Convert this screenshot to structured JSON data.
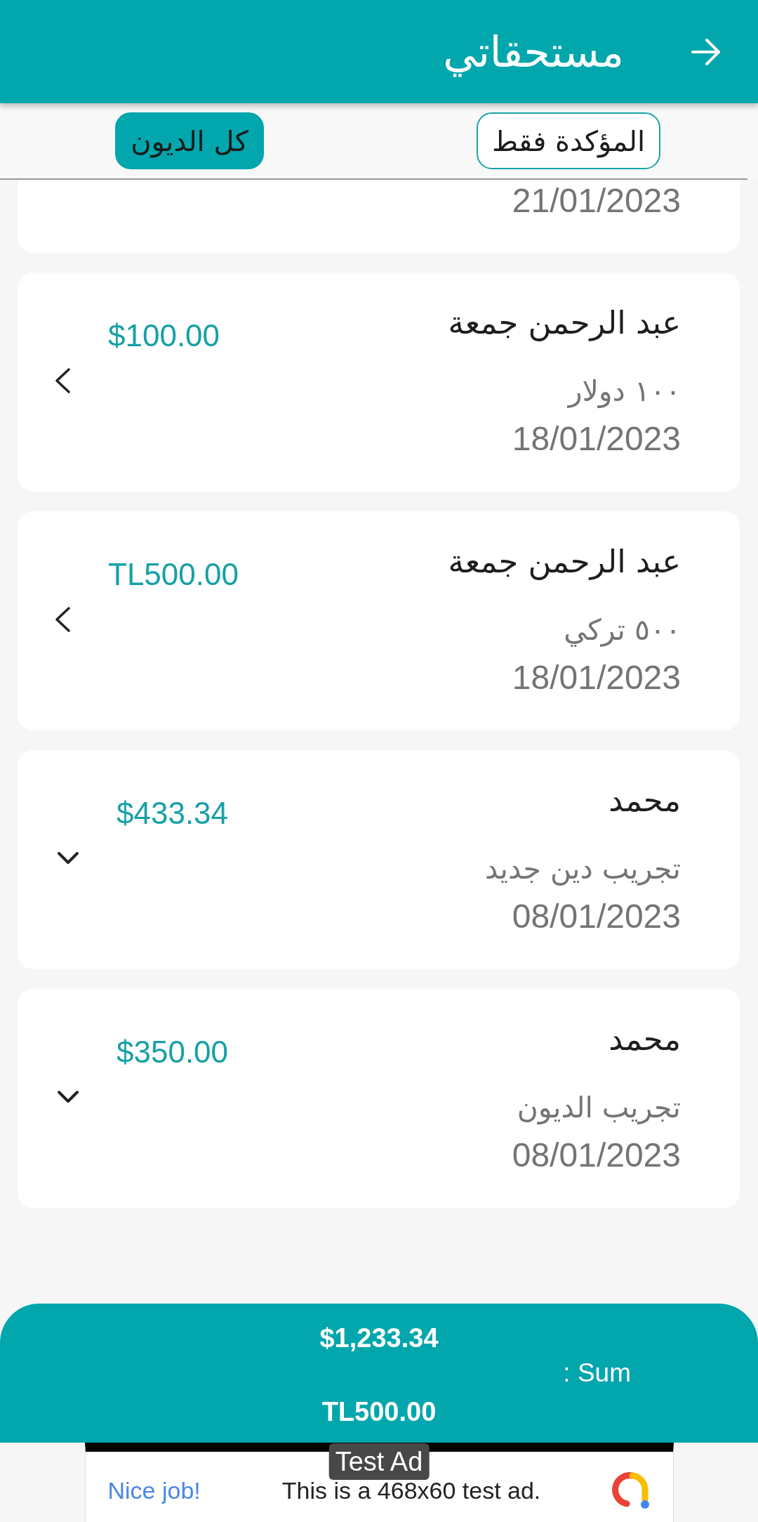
{
  "header": {
    "title": "مستحقاتي"
  },
  "filters": [
    {
      "label": "المؤكدة فقط",
      "selected": false
    },
    {
      "label": "كل الديون",
      "selected": true
    }
  ],
  "debts": [
    {
      "date": "21/01/2023"
    },
    {
      "name": "عبد الرحمن جمعة",
      "note": "١٠٠ دولار",
      "date": "18/01/2023",
      "amount": "$100.00",
      "expanded": false
    },
    {
      "name": "عبد الرحمن جمعة",
      "note": "٥٠٠ تركي",
      "date": "18/01/2023",
      "amount": "TL500.00",
      "expanded": false
    },
    {
      "name": "محمد",
      "note": "تجريب دين جديد",
      "date": "08/01/2023",
      "amount": "$433.34",
      "expanded": true
    },
    {
      "name": "محمد",
      "note": "تجريب الديون",
      "date": "08/01/2023",
      "amount": "$350.00",
      "expanded": true
    }
  ],
  "summary": {
    "label": ": Sum",
    "totals": [
      "$1,233.34",
      "TL500.00"
    ]
  },
  "ad": {
    "tag": "Test Ad",
    "headline": "Nice job!",
    "text": "This is a 468x60 test ad."
  }
}
